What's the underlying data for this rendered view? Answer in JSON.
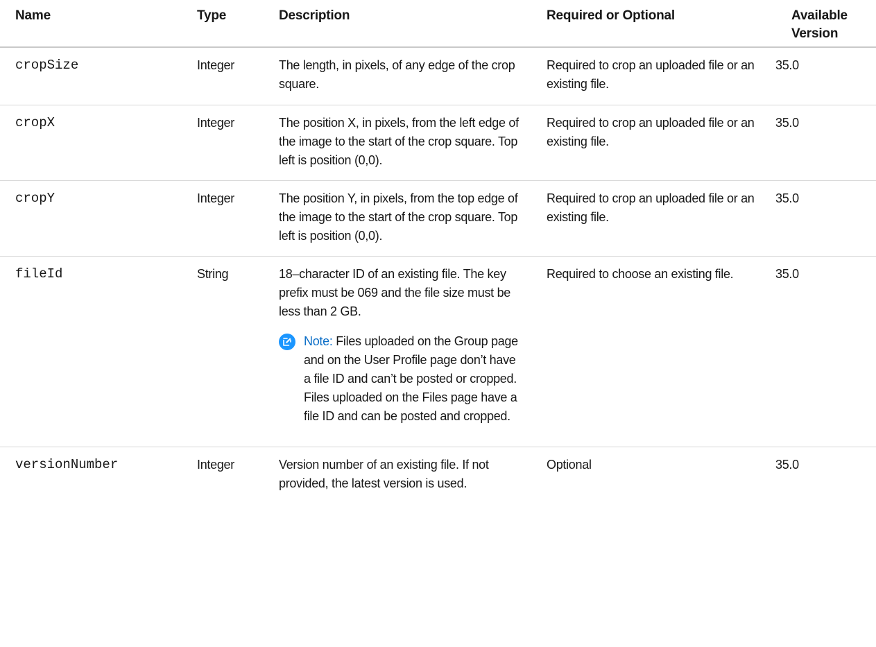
{
  "table": {
    "headers": {
      "name": "Name",
      "type": "Type",
      "description": "Description",
      "required": "Required or Optional",
      "version": "Available Version"
    },
    "rows": [
      {
        "name": "cropSize",
        "type": "Integer",
        "description": "The length, in pixels, of any edge of the crop square.",
        "required": "Required to crop an uploaded file or an existing file.",
        "version": "35.0"
      },
      {
        "name": "cropX",
        "type": "Integer",
        "description": "The position X, in pixels, from the left edge of the image to the start of the crop square. Top left is position (0,0).",
        "required": "Required to crop an uploaded file or an existing file.",
        "version": "35.0"
      },
      {
        "name": "cropY",
        "type": "Integer",
        "description": "The position Y, in pixels, from the top edge of the image to the start of the crop square. Top left is position (0,0).",
        "required": "Required to crop an uploaded file or an existing file.",
        "version": "35.0"
      },
      {
        "name": "fileId",
        "type": "String",
        "description": "18–character ID of an existing file. The key prefix must be 069 and the file size must be less than 2 GB.",
        "note_label": "Note:",
        "note_text": "Files uploaded on the Group page and on the User Profile page don’t have a file ID and can’t be posted or cropped. Files uploaded on the Files page have a file ID and can be posted and cropped.",
        "note_icon": "edit-note-icon",
        "required": "Required to choose an existing file.",
        "version": "35.0"
      },
      {
        "name": "versionNumber",
        "type": "Integer",
        "description": "Version number of an existing file. If not provided, the latest version is used.",
        "required": "Optional",
        "version": "35.0"
      }
    ]
  },
  "colors": {
    "note_accent": "#1b96ff",
    "note_label": "#0b6ec7"
  }
}
